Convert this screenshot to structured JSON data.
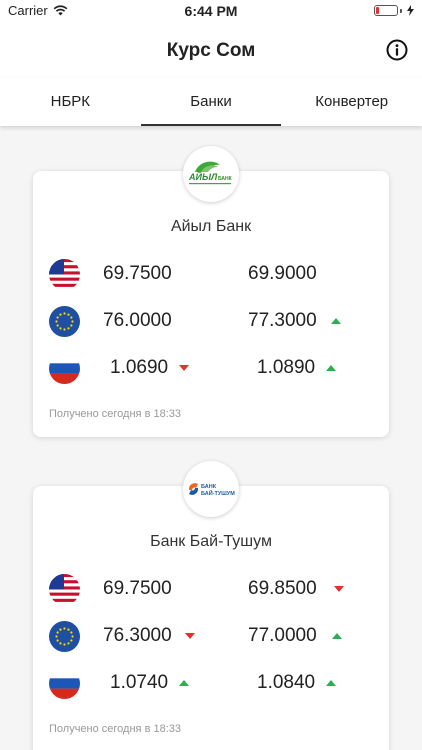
{
  "status": {
    "carrier": "Carrier",
    "time": "6:44 PM"
  },
  "header": {
    "title": "Курс Сом"
  },
  "tabs": [
    {
      "label": "НБРК",
      "active": false
    },
    {
      "label": "Банки",
      "active": true
    },
    {
      "label": "Конвертер",
      "active": false
    }
  ],
  "colors": {
    "up": "#2fae4f",
    "down": "#e0322f"
  },
  "banks": [
    {
      "name": "Айыл Банк",
      "logo_text": "АЙЫЛ БАНК",
      "rates": [
        {
          "currency": "usd-flag-icon",
          "buy": "69.7500",
          "buy_trend": "none",
          "sell": "69.9000",
          "sell_trend": "none"
        },
        {
          "currency": "eu-flag-icon",
          "buy": "76.0000",
          "buy_trend": "none",
          "sell": "77.3000",
          "sell_trend": "up"
        },
        {
          "currency": "ru-flag-icon",
          "buy": "1.0690",
          "buy_trend": "down",
          "sell": "1.0890",
          "sell_trend": "up"
        }
      ],
      "updated": "Получено сегодня в 18:33"
    },
    {
      "name": "Банк Бай-Тушум",
      "logo_text": "БАНК БАЙ-ТУШУМ",
      "rates": [
        {
          "currency": "usd-flag-icon",
          "buy": "69.7500",
          "buy_trend": "none",
          "sell": "69.8500",
          "sell_trend": "down"
        },
        {
          "currency": "eu-flag-icon",
          "buy": "76.3000",
          "buy_trend": "down",
          "sell": "77.0000",
          "sell_trend": "up"
        },
        {
          "currency": "ru-flag-icon",
          "buy": "1.0740",
          "buy_trend": "up",
          "sell": "1.0840",
          "sell_trend": "up"
        }
      ],
      "updated": "Получено сегодня в 18:33"
    }
  ]
}
